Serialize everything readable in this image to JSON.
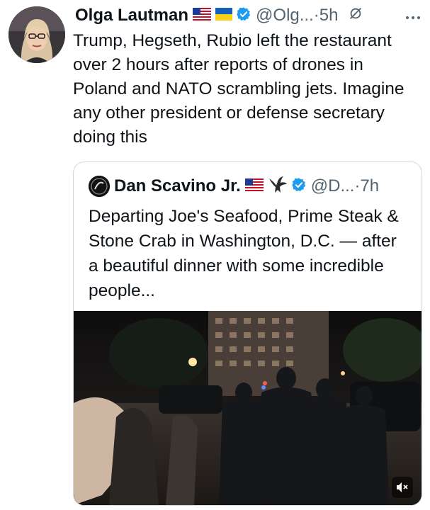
{
  "tweet": {
    "author_name": "Olga Lautman",
    "flags": [
      "us-flag-icon",
      "ukraine-flag-icon"
    ],
    "handle": "@Olg...",
    "separator": "·",
    "time": "5h",
    "text": "Trump, Hegseth, Rubio left the restaurant over 2 hours after reports of drones in Poland and NATO scrambling jets. Imagine any other president or defense secretary doing this"
  },
  "quote": {
    "author_name": "Dan Scavino Jr.",
    "handle": "@D...",
    "separator": "·",
    "time": "7h",
    "text": "Departing Joe's Seafood, Prime Steak & Stone Crab in Washington, D.C. — after a beautiful dinner with some incredible people..."
  },
  "colors": {
    "verified_blue": "#1d9bf0",
    "text_primary": "#0f1419",
    "text_secondary": "#536471",
    "border": "#cfd9de"
  }
}
